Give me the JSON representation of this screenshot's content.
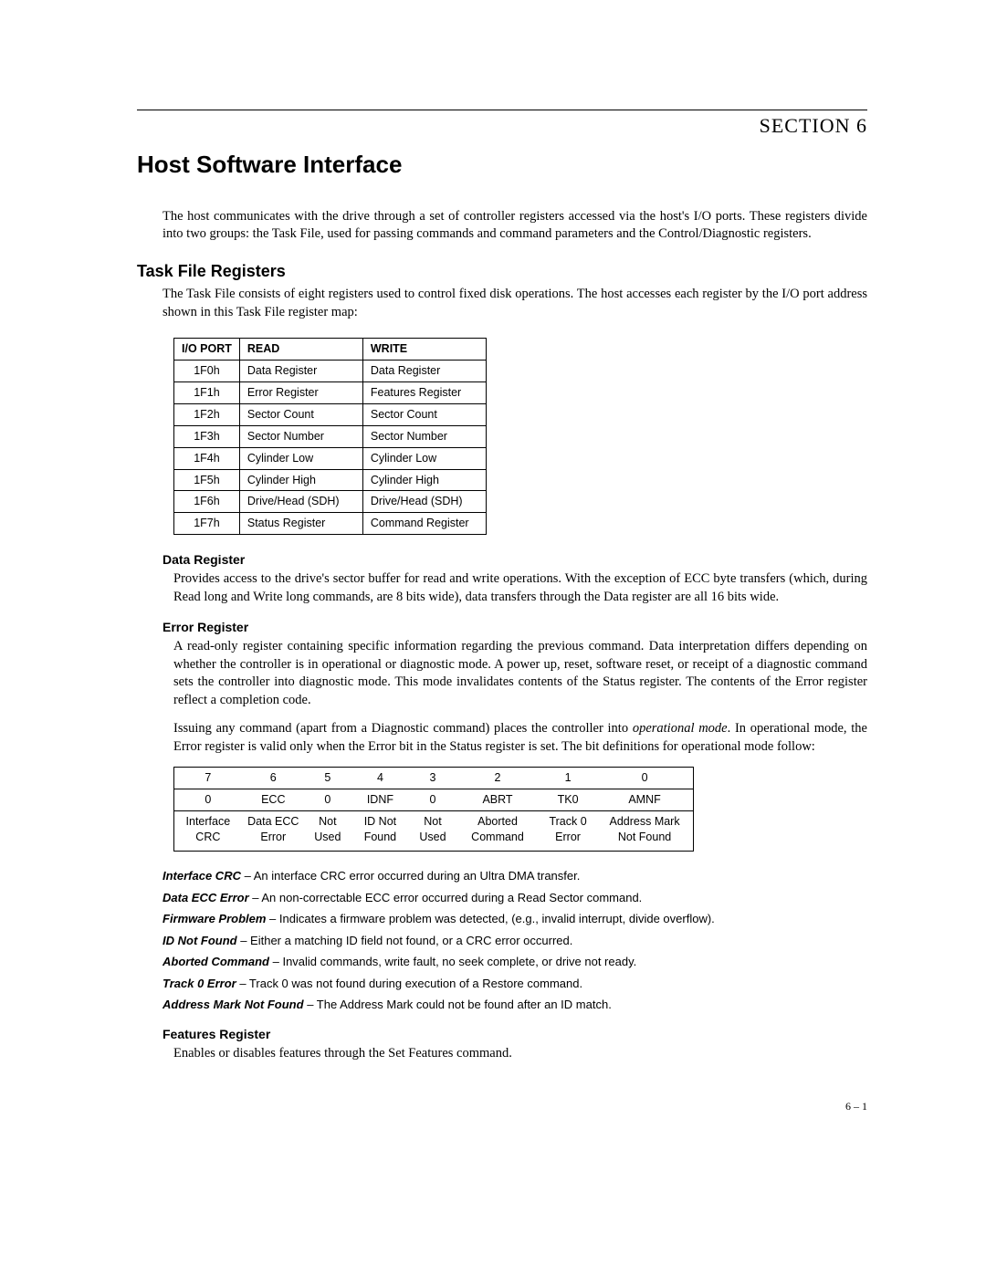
{
  "header": {
    "section_label": "SECTION 6"
  },
  "title": "Host Software Interface",
  "intro": "The host communicates with the drive through a set of controller registers accessed via the host's I/O ports. These registers divide into two groups: the Task File, used for passing commands and command parameters and the Control/Diagnostic registers.",
  "task_file": {
    "heading": "Task File Registers",
    "intro": "The Task File consists of eight registers used to control fixed disk operations. The host accesses each register by the I/O port address shown in this Task File register map:",
    "cols": {
      "port": "I/O PORT",
      "read": "READ",
      "write": "WRITE"
    },
    "rows": [
      {
        "port": "1F0h",
        "read": "Data Register",
        "write": "Data Register"
      },
      {
        "port": "1F1h",
        "read": "Error Register",
        "write": "Features Register"
      },
      {
        "port": "1F2h",
        "read": "Sector Count",
        "write": "Sector Count"
      },
      {
        "port": "1F3h",
        "read": "Sector Number",
        "write": "Sector Number"
      },
      {
        "port": "1F4h",
        "read": "Cylinder Low",
        "write": "Cylinder Low"
      },
      {
        "port": "1F5h",
        "read": "Cylinder High",
        "write": "Cylinder High"
      },
      {
        "port": "1F6h",
        "read": "Drive/Head (SDH)",
        "write": "Drive/Head (SDH)"
      },
      {
        "port": "1F7h",
        "read": "Status Register",
        "write": "Command Register"
      }
    ]
  },
  "data_register": {
    "heading": "Data Register",
    "body": "Provides access to the drive's sector buffer for read and write operations. With the exception of ECC byte transfers (which, during Read long and Write long commands, are 8 bits wide), data transfers through the Data register are all 16 bits wide."
  },
  "error_register": {
    "heading": "Error Register",
    "p1": "A read-only register containing specific information regarding the previous command. Data interpretation differs depending on whether the controller is in operational or diagnostic mode. A power up, reset, software reset, or receipt of a diagnostic command sets the controller into diagnostic mode. This mode invalidates contents of the Status register. The contents of the Error register reflect a completion code.",
    "p2a": "Issuing any command (apart from a Diagnostic command) places the controller into ",
    "p2_em": "operational mode",
    "p2b": ". In operational mode, the Error register is valid only when the Error bit in the Status register is set. The bit definitions for operational mode follow:",
    "bits": {
      "nums": [
        "7",
        "6",
        "5",
        "4",
        "3",
        "2",
        "1",
        "0"
      ],
      "codes": [
        "0",
        "ECC",
        "0",
        "IDNF",
        "0",
        "ABRT",
        "TK0",
        "AMNF"
      ],
      "descs": [
        "Interface CRC",
        "Data ECC Error",
        "Not Used",
        "ID Not Found",
        "Not Used",
        "Aborted Command",
        "Track 0 Error",
        "Address Mark Not Found"
      ]
    },
    "defs": [
      {
        "term": "Interface CRC",
        "desc": " – An interface CRC error occurred during an Ultra DMA transfer."
      },
      {
        "term": "Data ECC Error",
        "desc": " – An non-correctable ECC error occurred during a Read Sector command."
      },
      {
        "term": "Firmware Problem",
        "desc": " – Indicates a firmware problem was detected, (e.g., invalid interrupt, divide overflow)."
      },
      {
        "term": "ID Not Found",
        "desc": " – Either a matching ID field not found, or a CRC error occurred."
      },
      {
        "term": "Aborted Command",
        "desc": " – Invalid commands, write fault, no seek complete, or drive not ready."
      },
      {
        "term": "Track 0 Error",
        "desc": " – Track 0 was not found during execution of a Restore command."
      },
      {
        "term": "Address Mark Not Found",
        "desc": " – The Address Mark could not be found after an ID match."
      }
    ]
  },
  "features_register": {
    "heading": "Features Register",
    "body": "Enables or disables features through the Set Features command."
  },
  "footer": "6 – 1"
}
